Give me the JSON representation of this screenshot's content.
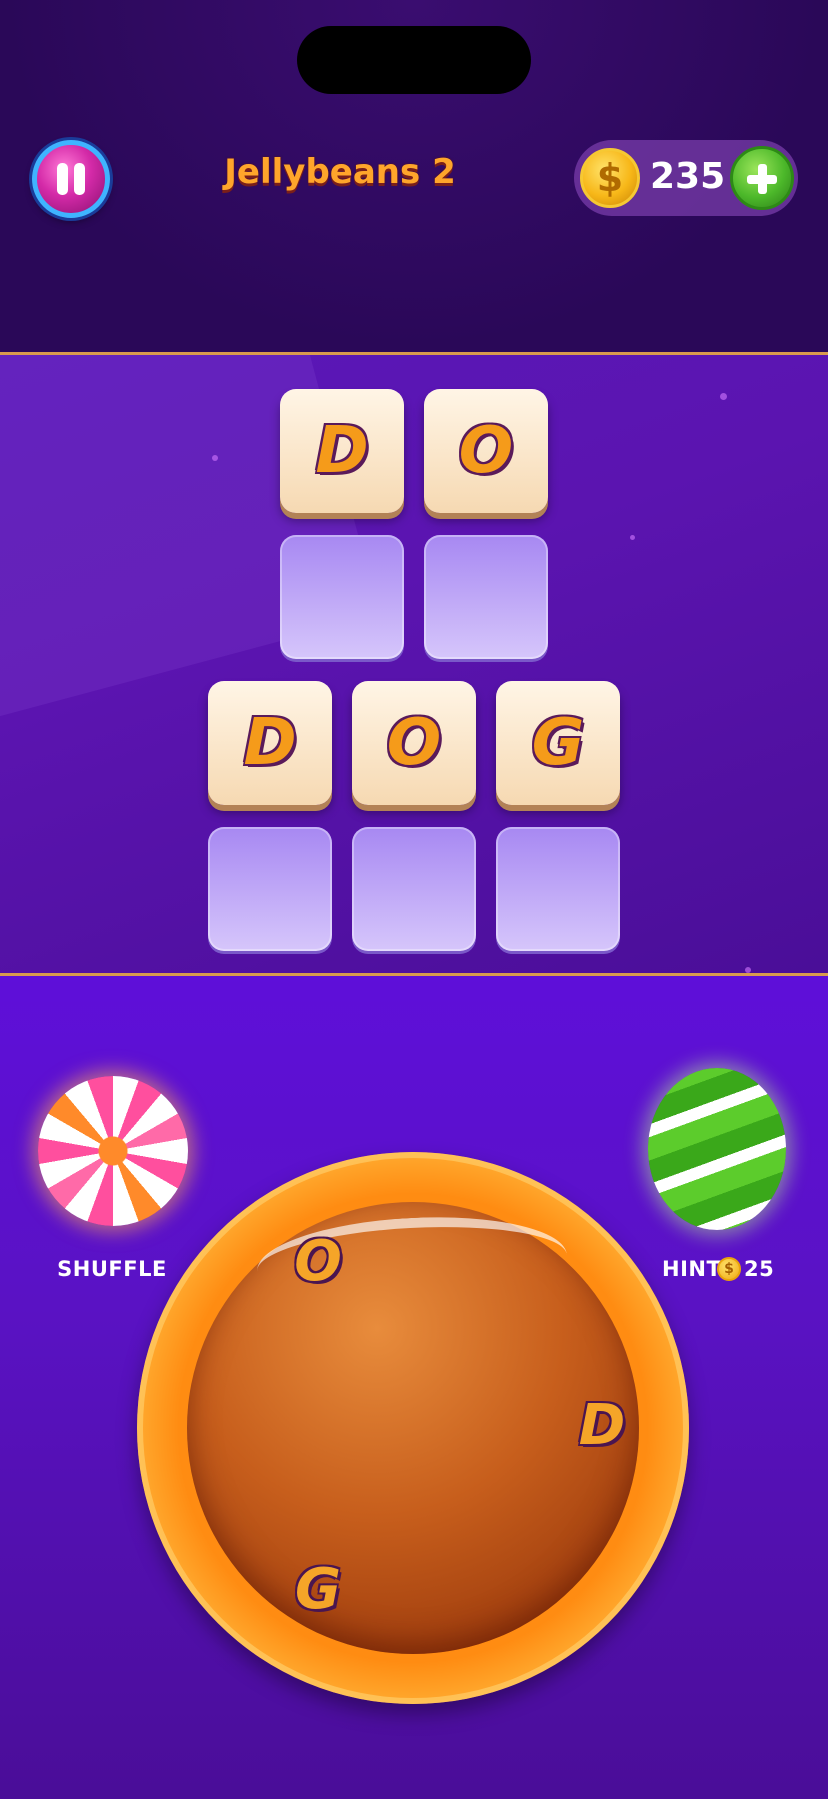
{
  "header": {
    "level_title": "Jellybeans 2",
    "coins": "235",
    "coin_symbol": "$",
    "pause_icon": "pause-icon",
    "add_coins_icon": "plus-icon"
  },
  "board": {
    "rows": [
      {
        "tiles": [
          {
            "letter": "D",
            "state": "filled"
          },
          {
            "letter": "O",
            "state": "filled"
          }
        ]
      },
      {
        "tiles": [
          {
            "letter": "",
            "state": "empty"
          },
          {
            "letter": "",
            "state": "empty"
          }
        ]
      },
      {
        "tiles": [
          {
            "letter": "D",
            "state": "filled"
          },
          {
            "letter": "O",
            "state": "filled"
          },
          {
            "letter": "G",
            "state": "filled"
          }
        ]
      },
      {
        "tiles": [
          {
            "letter": "",
            "state": "empty"
          },
          {
            "letter": "",
            "state": "empty"
          },
          {
            "letter": "",
            "state": "empty"
          }
        ]
      }
    ]
  },
  "powerups": {
    "shuffle_label": "SHUFFLE",
    "hint_label": "HINT",
    "hint_cost": "25",
    "hint_coin_symbol": "$"
  },
  "wheel": {
    "letters": [
      "O",
      "D",
      "G"
    ]
  },
  "colors": {
    "accent_orange": "#ff8c12",
    "background_purple": "#4a0f92",
    "tile_cream": "#f6d9b2",
    "tile_empty": "#a788f2"
  }
}
